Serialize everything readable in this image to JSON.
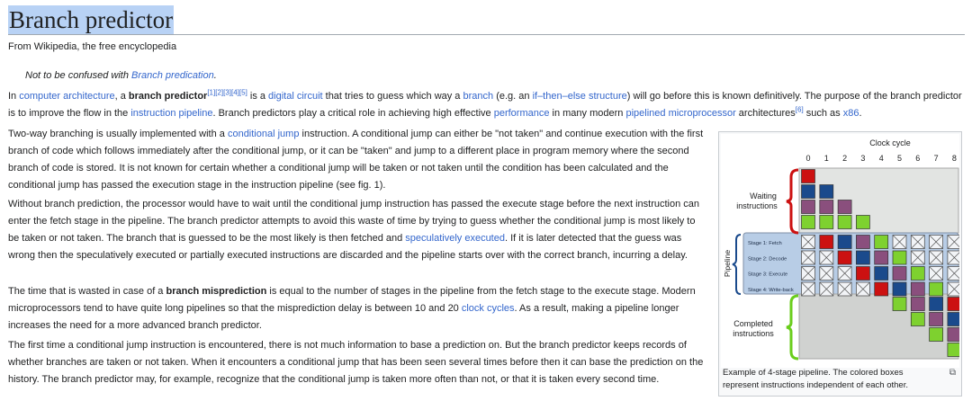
{
  "article": {
    "title": "Branch predictor",
    "tagline": "From Wikipedia, the free encyclopedia",
    "hatnote": {
      "prefix": "Not to be confused with ",
      "link": "Branch predication",
      "suffix": "."
    },
    "p1": {
      "t1": "In ",
      "l_computer_architecture": "computer architecture",
      "t2": ", a ",
      "bold": "branch predictor",
      "refs": "[1][2][3][4][5]",
      "t3": " is a ",
      "l_digital_circuit": "digital circuit",
      "t4": " that tries to guess which way a ",
      "l_branch": "branch",
      "t5": " (e.g. an ",
      "l_ifthen": "if–then–else structure",
      "t6": ") will go before this is known definitively. The purpose of the branch predictor is to improve the flow in the ",
      "l_pipeline": "instruction pipeline",
      "t7": ". Branch predictors play a critical role in achieving high effective ",
      "l_performance": "performance",
      "t8": " in many modern ",
      "l_pipelined": "pipelined",
      "t9": " ",
      "l_microprocessor": "microprocessor",
      "t10": " architectures",
      "ref6": "[6]",
      "t11": " such as ",
      "l_x86": "x86",
      "t12": "."
    },
    "p2": {
      "t1": "Two-way branching is usually implemented with a ",
      "l_conditional_jump": "conditional jump",
      "t2": " instruction. A conditional jump can either be \"not taken\" and continue execution with the first branch of code which follows immediately after the conditional jump, or it can be \"taken\" and jump to a different place in program memory where the second branch of code is stored. It is not known for certain whether a conditional jump will be taken or not taken until the condition has been calculated and the conditional jump has passed the execution stage in the instruction pipeline (see fig. 1)."
    },
    "p3": {
      "t1": "Without branch prediction, the processor would have to wait until the conditional jump instruction has passed the execute stage before the next instruction can enter the fetch stage in the pipeline. The branch predictor attempts to avoid this waste of time by trying to guess whether the conditional jump is most likely to be taken or not taken. The branch that is guessed to be the most likely is then fetched and ",
      "l_speculative": "speculatively executed",
      "t2": ". If it is later detected that the guess was wrong then the speculatively executed or partially executed instructions are discarded and the pipeline starts over with the correct branch, incurring a delay."
    },
    "p4": {
      "t1": "The time that is wasted in case of a ",
      "bold": "branch misprediction",
      "t2": " is equal to the number of stages in the pipeline from the fetch stage to the execute stage. Modern microprocessors tend to have quite long pipelines so that the misprediction delay is between 10 and 20 ",
      "l_clock": "clock cycles",
      "t3": ". As a result, making a pipeline longer increases the need for a more advanced branch predictor."
    },
    "p5": {
      "t1": "The first time a conditional jump instruction is encountered, there is not much information to base a prediction on. But the branch predictor keeps records of whether branches are taken or not taken. When it encounters a conditional jump that has been seen several times before then it can base the prediction on the history. The branch predictor may, for example, recognize that the conditional jump is taken more often than not, or that it is taken every second time."
    }
  },
  "figure": {
    "clock_title": "Clock cycle",
    "cycles": [
      "0",
      "1",
      "2",
      "3",
      "4",
      "5",
      "6",
      "7",
      "8"
    ],
    "waiting_line1": "Waiting",
    "waiting_line2": "instructions",
    "pipeline_label": "Pipeline",
    "stages": [
      "Stage 1: Fetch",
      "Stage 2: Decode",
      "Stage 3: Execute",
      "Stage 4: Write-back"
    ],
    "completed_line1": "Completed",
    "completed_line2": "instructions",
    "caption": "Example of 4-stage pipeline. The colored boxes represent instructions independent of each other.",
    "enlarge_icon": "enlarge-icon",
    "colors": {
      "red": "#cc1111",
      "blue": "#1a4a8c",
      "purple": "#8a4f7d",
      "green": "#7ed12f",
      "waiting_bg": "#e2e4e2",
      "pipeline_bg": "#b8cde6",
      "completed_bg": "#d0d2d0",
      "brace_red": "#cc1111",
      "brace_blue": "#1a4a8c",
      "brace_green": "#6acd1c"
    }
  }
}
